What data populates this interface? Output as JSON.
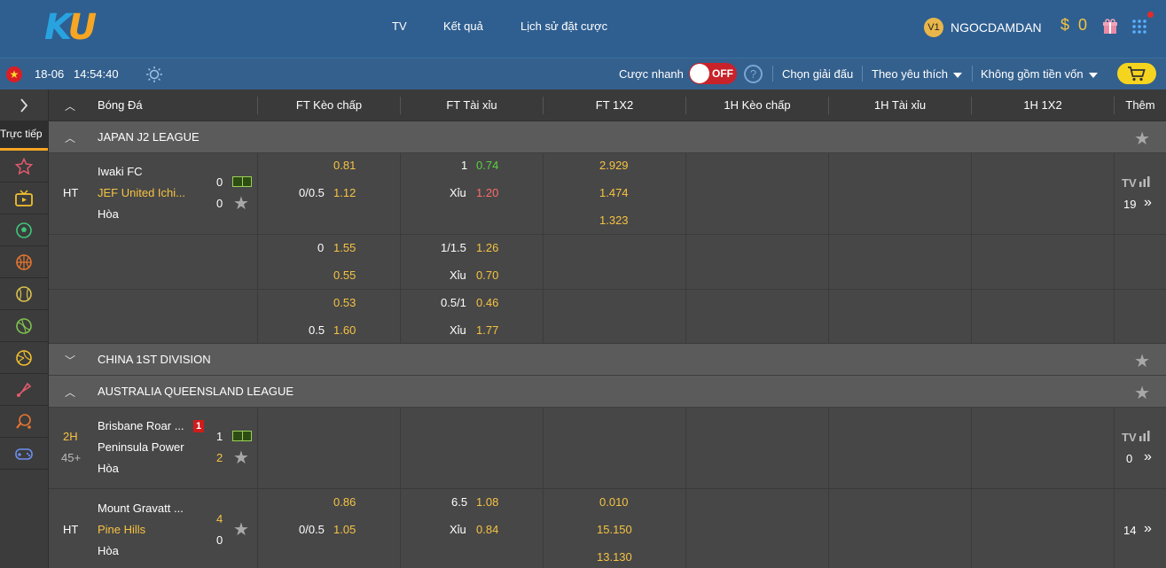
{
  "header": {
    "logo_k": "K",
    "logo_u": "U",
    "nav": [
      "TV",
      "Kết quả",
      "Lịch sử đặt cược"
    ],
    "vip": "V1",
    "username": "NGOCDAMDAN",
    "balance_symbol": "$",
    "balance": "0"
  },
  "subbar": {
    "date": "18-06",
    "time": "14:54:40",
    "quick_bet": "Cược nhanh",
    "toggle": "OFF",
    "help": "?",
    "choose_league": "Chọn giải đấu",
    "sort": "Theo yêu thích",
    "odds_filter": "Không gồm tiền vốn"
  },
  "sidebar": {
    "live": "Trực tiếp",
    "items": [
      "favorites",
      "tv",
      "soccer",
      "basketball",
      "baseball",
      "tennis",
      "volleyball",
      "badminton",
      "table-tennis",
      "esports"
    ]
  },
  "columns": {
    "sport": "Bóng Đá",
    "ft_hdp": "FT Kèo chấp",
    "ft_ou": "FT Tài xỉu",
    "ft_1x2": "FT 1X2",
    "h1_hdp": "1H Kèo chấp",
    "h1_ou": "1H Tài xỉu",
    "h1_1x2": "1H 1X2",
    "more": "Thêm"
  },
  "leagues": {
    "japan": "JAPAN J2 LEAGUE",
    "china": "CHINA 1ST DIVISION",
    "australia": "AUSTRALIA QUEENSLAND LEAGUE"
  },
  "match1": {
    "status": "HT",
    "home": "Iwaki FC",
    "away": "JEF United Ichi...",
    "draw": "Hòa",
    "score_home": "0",
    "score_away": "0",
    "tv": "TV",
    "more": "19",
    "rows": [
      {
        "hdp_home": "0.81",
        "ou_line": "1",
        "ou_over": "0.74",
        "x12_home": "2.929"
      },
      {
        "hdp_line": "0/0.5",
        "hdp_away": "1.12",
        "ou_under_label": "Xỉu",
        "ou_under": "1.20",
        "x12_away": "1.474"
      },
      {
        "x12_draw": "1.323"
      },
      {
        "hdp_line": "0",
        "hdp_home": "1.55",
        "ou_line": "1/1.5",
        "ou_over": "1.26"
      },
      {
        "hdp_away": "0.55",
        "ou_under_label": "Xỉu",
        "ou_under": "0.70"
      },
      {
        "hdp_home": "0.53",
        "ou_line": "0.5/1",
        "ou_over": "0.46"
      },
      {
        "hdp_line": "0.5",
        "hdp_away": "1.60",
        "ou_under_label": "Xỉu",
        "ou_under": "1.77"
      }
    ]
  },
  "match2": {
    "status": "2H",
    "minute": "45+",
    "home": "Brisbane Roar ...",
    "red_cards": "1",
    "away": "Peninsula Power",
    "draw": "Hòa",
    "score_home": "1",
    "score_away": "2",
    "tv": "TV",
    "more": "0"
  },
  "match3": {
    "status": "HT",
    "home": "Mount Gravatt ...",
    "away": "Pine Hills",
    "draw": "Hòa",
    "score_home": "4",
    "score_away": "0",
    "more": "14",
    "rows": [
      {
        "hdp_home": "0.86",
        "ou_line": "6.5",
        "ou_over": "1.08",
        "x12_home": "0.010"
      },
      {
        "hdp_line": "0/0.5",
        "hdp_away": "1.05",
        "ou_under_label": "Xỉu",
        "ou_under": "0.84",
        "x12_away": "15.150"
      },
      {
        "x12_draw": "13.130"
      }
    ]
  },
  "colors": {
    "header_bg": "#2f5f90",
    "accent_yellow": "#f6c342",
    "odds_up_green": "#58d23d",
    "odds_down_red": "#ff6b6b",
    "toggle_red": "#c8222a",
    "cart_yellow": "#f5d41f"
  }
}
